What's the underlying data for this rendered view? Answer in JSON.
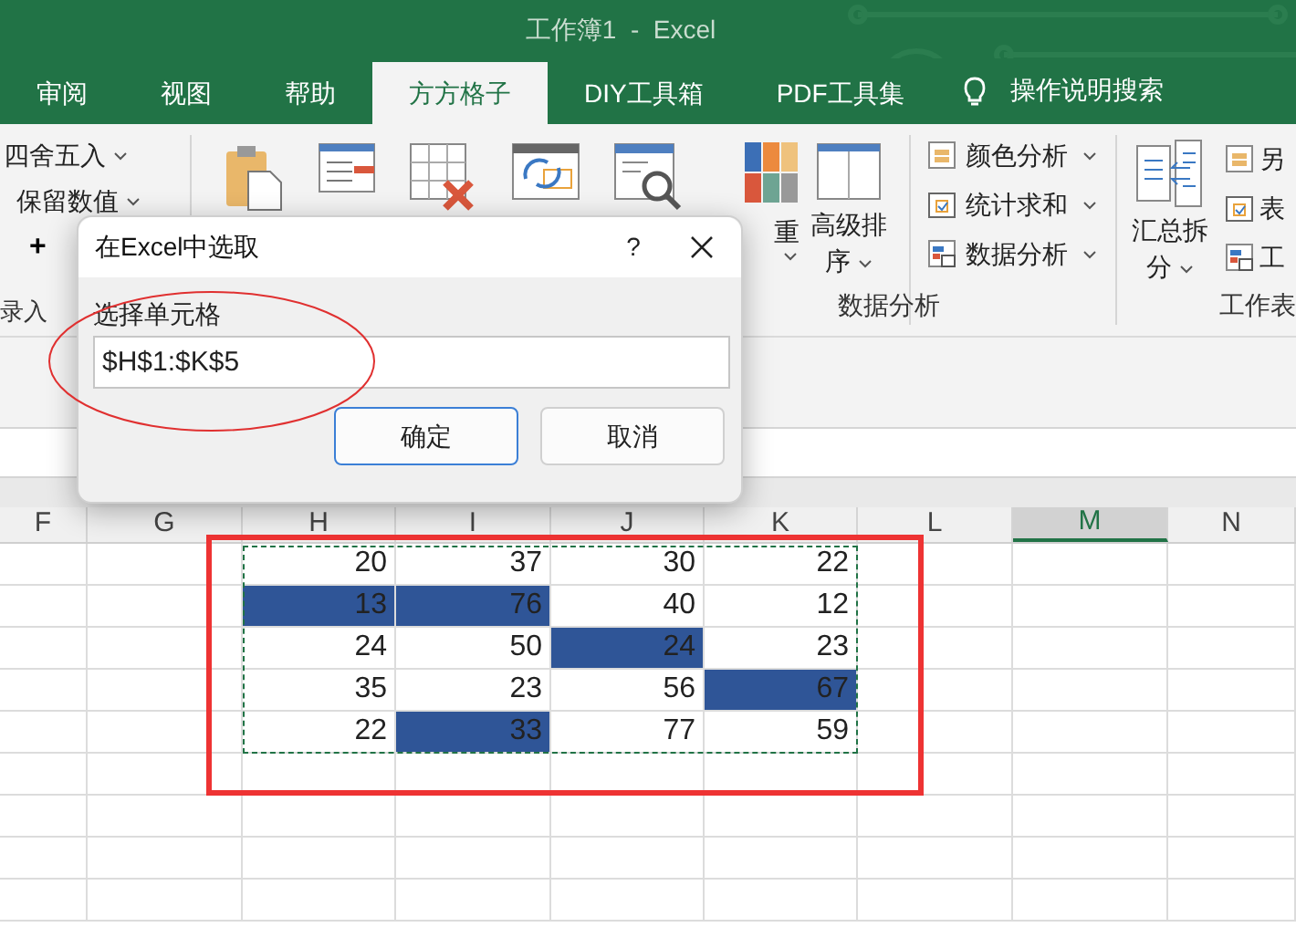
{
  "window": {
    "title": "工作簿1  -  Excel"
  },
  "tabs": [
    {
      "label": "审阅",
      "selected": false
    },
    {
      "label": "视图",
      "selected": false
    },
    {
      "label": "帮助",
      "selected": false
    },
    {
      "label": "方方格子",
      "selected": true
    },
    {
      "label": "DIY工具箱",
      "selected": false
    },
    {
      "label": "PDF工具集",
      "selected": false
    }
  ],
  "tell_me": "操作说明搜索",
  "ribbon": {
    "left_items": [
      "四舍五入",
      "保留数值"
    ],
    "plus": "+",
    "left_group_label": "录入",
    "partial_button": "重",
    "sort_button": {
      "line1": "高级排",
      "line2": "序"
    },
    "small_buttons": [
      "颜色分析",
      "统计求和",
      "数据分析"
    ],
    "group_label": "数据分析",
    "split_button": {
      "line1": "汇总拆",
      "line2": "分"
    },
    "sheet_buttons": [
      "另",
      "表",
      "工"
    ],
    "sheet_group_label": "工作表"
  },
  "dialog": {
    "title": "在Excel中选取",
    "help": "?",
    "field_label": "选择单元格",
    "value": "$H$1:$K$5",
    "buttons": [
      {
        "label": "确定",
        "selected": true
      },
      {
        "label": "取消",
        "selected": false
      }
    ]
  },
  "sheet": {
    "columns": [
      {
        "label": "F",
        "selected": false
      },
      {
        "label": "G",
        "selected": false
      },
      {
        "label": "H",
        "selected": false
      },
      {
        "label": "I",
        "selected": false
      },
      {
        "label": "J",
        "selected": false
      },
      {
        "label": "K",
        "selected": false
      },
      {
        "label": "L",
        "selected": false
      },
      {
        "label": "M",
        "selected": true
      },
      {
        "label": "N",
        "selected": false
      }
    ],
    "rows": [
      [
        {
          "value": "20",
          "highlighted": false
        },
        {
          "value": "37",
          "highlighted": false
        },
        {
          "value": "30",
          "highlighted": false
        },
        {
          "value": "22",
          "highlighted": false
        }
      ],
      [
        {
          "value": "13",
          "highlighted": true
        },
        {
          "value": "76",
          "highlighted": true
        },
        {
          "value": "40",
          "highlighted": false
        },
        {
          "value": "12",
          "highlighted": false
        }
      ],
      [
        {
          "value": "24",
          "highlighted": false
        },
        {
          "value": "50",
          "highlighted": false
        },
        {
          "value": "24",
          "highlighted": true
        },
        {
          "value": "23",
          "highlighted": false
        }
      ],
      [
        {
          "value": "35",
          "highlighted": false
        },
        {
          "value": "23",
          "highlighted": false
        },
        {
          "value": "56",
          "highlighted": false
        },
        {
          "value": "67",
          "highlighted": true
        }
      ],
      [
        {
          "value": "22",
          "highlighted": false
        },
        {
          "value": "33",
          "highlighted": true
        },
        {
          "value": "77",
          "highlighted": false
        },
        {
          "value": "59",
          "highlighted": false
        }
      ]
    ]
  }
}
